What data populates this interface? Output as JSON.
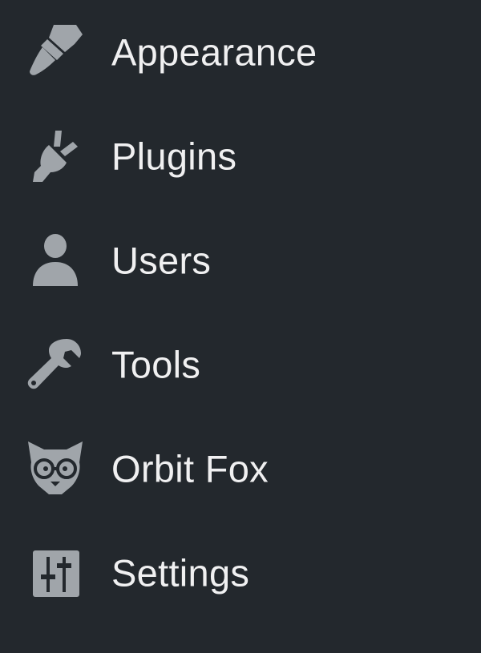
{
  "theme": {
    "background": "#23282d",
    "icon_color": "#a0a5aa",
    "label_color": "#f0f0f1"
  },
  "sidebar": {
    "items": [
      {
        "label": "Appearance",
        "icon": "paintbrush-icon"
      },
      {
        "label": "Plugins",
        "icon": "plugin-plug-icon"
      },
      {
        "label": "Users",
        "icon": "user-icon"
      },
      {
        "label": "Tools",
        "icon": "wrench-icon"
      },
      {
        "label": "Orbit Fox",
        "icon": "orbit-fox-logo-icon"
      },
      {
        "label": "Settings",
        "icon": "settings-sliders-icon"
      }
    ]
  }
}
